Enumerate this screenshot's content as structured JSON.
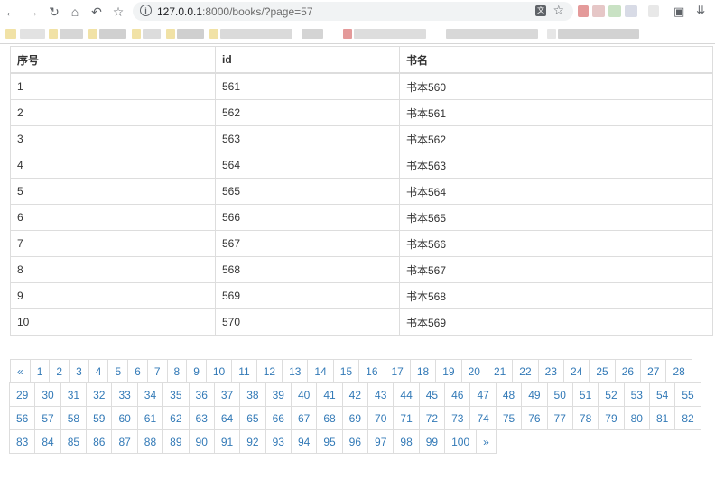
{
  "browser": {
    "url_host": "127.0.0.1",
    "url_rest": ":8000/books/?page=57",
    "icons": [
      "back-arrow-icon",
      "forward-arrow-icon",
      "reload-icon",
      "home-icon",
      "undo-icon",
      "star-icon",
      "info-icon",
      "translate-icon",
      "crop-icon",
      "chevron-double-down-icon"
    ]
  },
  "table": {
    "headers": [
      "序号",
      "id",
      "书名"
    ],
    "rows": [
      [
        "1",
        "561",
        "书本560"
      ],
      [
        "2",
        "562",
        "书本561"
      ],
      [
        "3",
        "563",
        "书本562"
      ],
      [
        "4",
        "564",
        "书本563"
      ],
      [
        "5",
        "565",
        "书本564"
      ],
      [
        "6",
        "566",
        "书本565"
      ],
      [
        "7",
        "567",
        "书本566"
      ],
      [
        "8",
        "568",
        "书本567"
      ],
      [
        "9",
        "569",
        "书本568"
      ],
      [
        "10",
        "570",
        "书本569"
      ]
    ]
  },
  "pagination": {
    "prev": "«",
    "next": "»",
    "pages": [
      "1",
      "2",
      "3",
      "4",
      "5",
      "6",
      "7",
      "8",
      "9",
      "10",
      "11",
      "12",
      "13",
      "14",
      "15",
      "16",
      "17",
      "18",
      "19",
      "20",
      "21",
      "22",
      "23",
      "24",
      "25",
      "26",
      "27",
      "28",
      "29",
      "30",
      "31",
      "32",
      "33",
      "34",
      "35",
      "36",
      "37",
      "38",
      "39",
      "40",
      "41",
      "42",
      "43",
      "44",
      "45",
      "46",
      "47",
      "48",
      "49",
      "50",
      "51",
      "52",
      "53",
      "54",
      "55",
      "56",
      "57",
      "58",
      "59",
      "60",
      "61",
      "62",
      "63",
      "64",
      "65",
      "66",
      "67",
      "68",
      "69",
      "70",
      "71",
      "72",
      "73",
      "74",
      "75",
      "76",
      "77",
      "78",
      "79",
      "80",
      "81",
      "82",
      "83",
      "84",
      "85",
      "86",
      "87",
      "88",
      "89",
      "90",
      "91",
      "92",
      "93",
      "94",
      "95",
      "96",
      "97",
      "98",
      "99",
      "100"
    ],
    "link_color": "#337ab7"
  }
}
